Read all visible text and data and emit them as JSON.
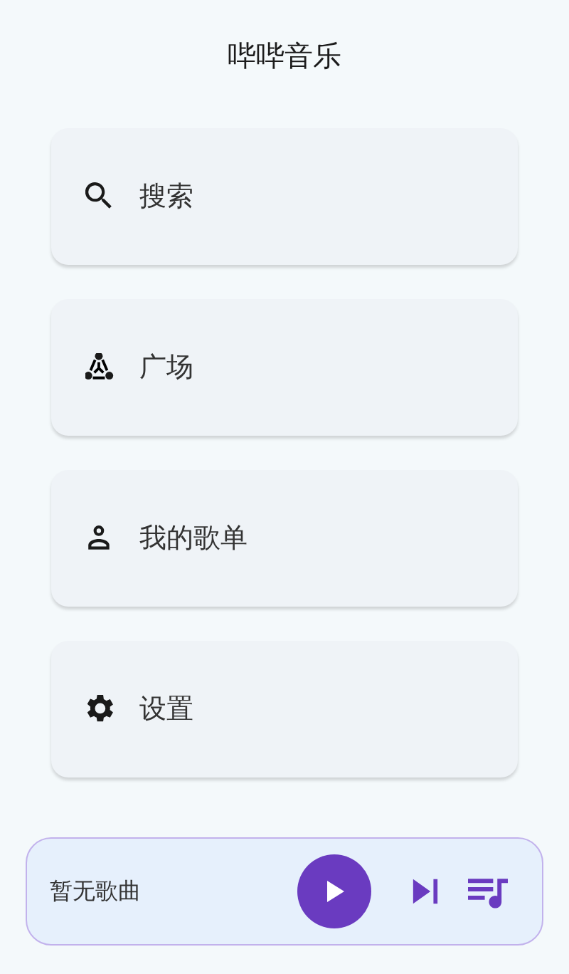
{
  "app_bar": {
    "title": "哔哔音乐"
  },
  "menu_items": [
    {
      "label": "搜索"
    },
    {
      "label": "广场"
    },
    {
      "label": "我的歌单"
    },
    {
      "label": "设置"
    }
  ],
  "player_bar": {
    "now_playing": "暂无歌曲",
    "playing": false
  }
}
